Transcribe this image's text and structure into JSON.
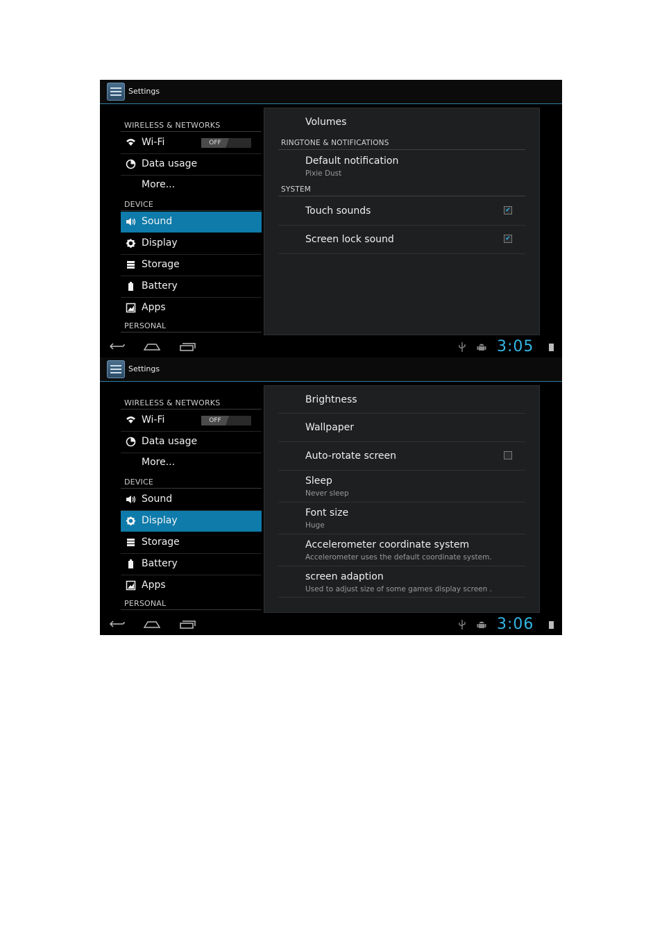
{
  "screens": [
    {
      "app_title": "Settings",
      "left": {
        "wireless_header": "WIRELESS & NETWORKS",
        "device_header": "DEVICE",
        "personal_header": "PERSONAL",
        "wifi": "Wi-Fi",
        "wifi_toggle": "OFF",
        "data_usage": "Data usage",
        "more": "More...",
        "sound": "Sound",
        "display": "Display",
        "storage": "Storage",
        "battery": "Battery",
        "apps": "Apps",
        "selected": "Sound"
      },
      "right": {
        "volumes": "Volumes",
        "ringtone_header": "RINGTONE & NOTIFICATIONS",
        "default_notification": "Default notification",
        "default_notification_value": "Pixie Dust",
        "system_header": "SYSTEM",
        "touch_sounds": "Touch sounds",
        "touch_sounds_checked": true,
        "screen_lock_sound": "Screen lock sound",
        "screen_lock_sound_checked": true
      },
      "clock": "3:05"
    },
    {
      "app_title": "Settings",
      "left": {
        "wireless_header": "WIRELESS & NETWORKS",
        "device_header": "DEVICE",
        "personal_header": "PERSONAL",
        "wifi": "Wi-Fi",
        "wifi_toggle": "OFF",
        "data_usage": "Data usage",
        "more": "More...",
        "sound": "Sound",
        "display": "Display",
        "storage": "Storage",
        "battery": "Battery",
        "apps": "Apps",
        "selected": "Display"
      },
      "right": {
        "brightness": "Brightness",
        "wallpaper": "Wallpaper",
        "auto_rotate": "Auto-rotate screen",
        "auto_rotate_checked": false,
        "sleep": "Sleep",
        "sleep_value": "Never sleep",
        "font_size": "Font size",
        "font_size_value": "Huge",
        "accelerometer": "Accelerometer coordinate system",
        "accelerometer_desc": "Accelerometer uses the default coordinate system.",
        "screen_adaption": "screen adaption",
        "screen_adaption_desc": "Used to adjust size of some games display screen ."
      },
      "clock": "3:06"
    }
  ],
  "icons": {
    "back": "back-icon",
    "home": "home-icon",
    "recents": "recents-icon",
    "usb": "usb-icon",
    "android_debug": "android-debug-icon",
    "battery": "battery-icon"
  },
  "colors": {
    "accent": "#33b5e5",
    "selected_item": "#0e7bab",
    "pane": "#1d1f21"
  }
}
